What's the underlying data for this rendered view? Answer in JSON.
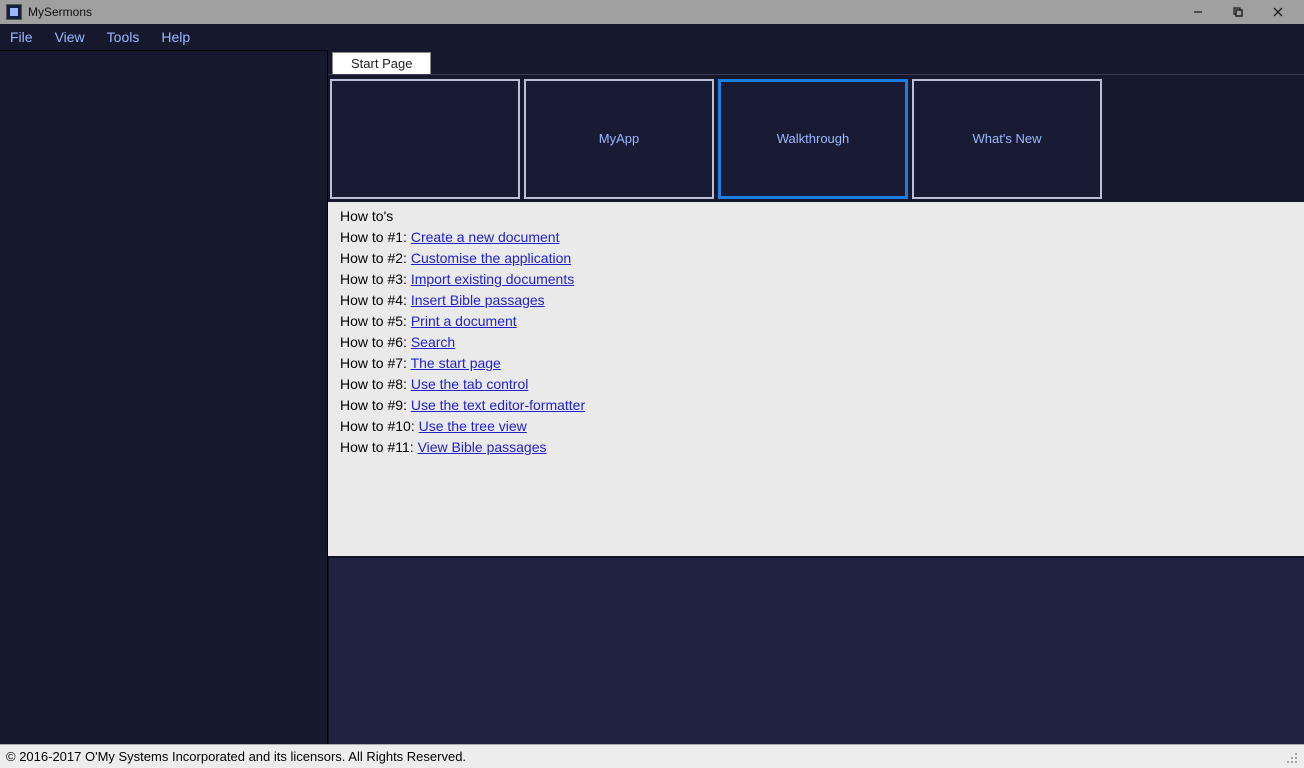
{
  "window": {
    "title": "MySermons"
  },
  "menubar": {
    "items": [
      "File",
      "View",
      "Tools",
      "Help"
    ]
  },
  "tab": {
    "label": "Start Page"
  },
  "cards": [
    {
      "label": ""
    },
    {
      "label": "MyApp"
    },
    {
      "label": "Walkthrough",
      "active": true
    },
    {
      "label": "What's New"
    }
  ],
  "howtos": {
    "heading": "How to's",
    "items": [
      {
        "prefix": "How to #1: ",
        "link": "Create a new document"
      },
      {
        "prefix": "How to #2: ",
        "link": "Customise the application"
      },
      {
        "prefix": "How to #3: ",
        "link": "Import existing documents"
      },
      {
        "prefix": "How to #4: ",
        "link": "Insert Bible passages"
      },
      {
        "prefix": "How to #5: ",
        "link": "Print a document"
      },
      {
        "prefix": "How to #6: ",
        "link": "Search"
      },
      {
        "prefix": "How to #7: ",
        "link": "The start page"
      },
      {
        "prefix": "How to #8: ",
        "link": "Use the tab control"
      },
      {
        "prefix": "How to #9: ",
        "link": "Use the text editor-formatter"
      },
      {
        "prefix": "How to #10: ",
        "link": "Use the tree view"
      },
      {
        "prefix": "How to #11: ",
        "link": "View Bible passages"
      }
    ]
  },
  "footer": {
    "text": "© 2016-2017 O'My Systems Incorporated and its licensors. All Rights Reserved."
  }
}
